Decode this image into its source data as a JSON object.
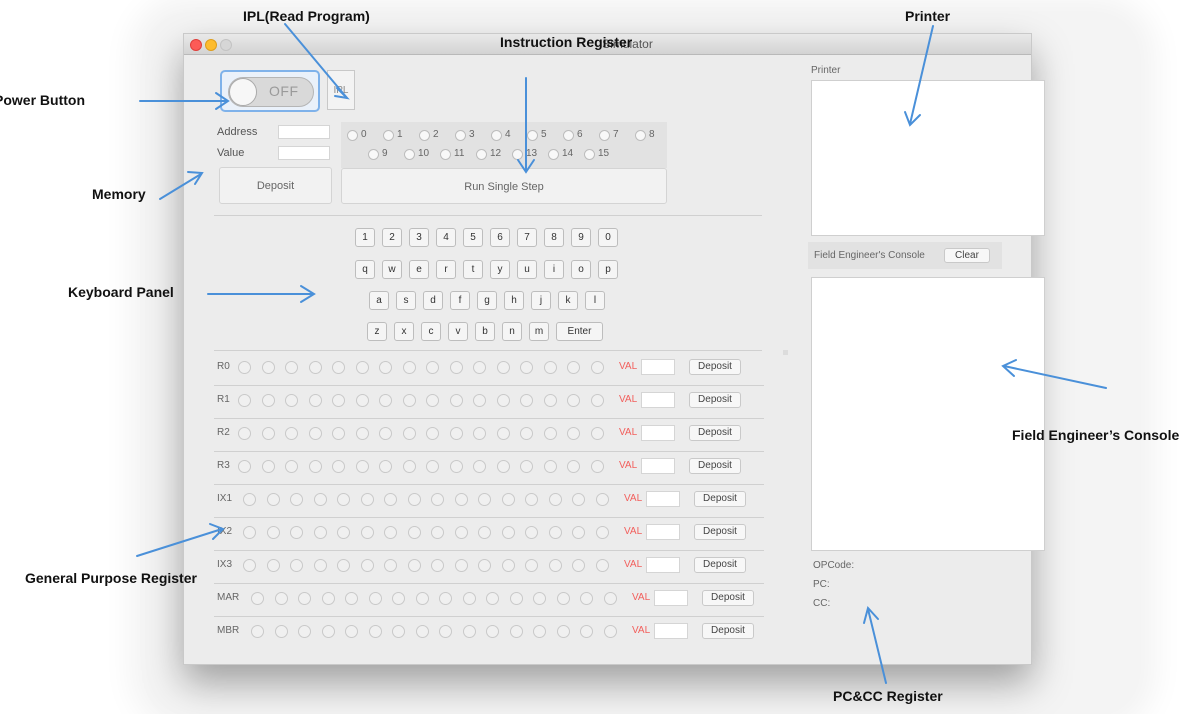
{
  "window": {
    "title": "Simulator"
  },
  "power": {
    "label": "OFF"
  },
  "ipl": {
    "label": "IPL"
  },
  "memory": {
    "address_label": "Address",
    "value_label": "Value",
    "address_value": "",
    "value_value": "",
    "deposit_label": "Deposit"
  },
  "instruction": {
    "bits": [
      "0",
      "1",
      "2",
      "3",
      "4",
      "5",
      "6",
      "7",
      "8",
      "9",
      "10",
      "11",
      "12",
      "13",
      "14",
      "15"
    ],
    "run_label": "Run Single Step"
  },
  "keyboard": {
    "row1": [
      "1",
      "2",
      "3",
      "4",
      "5",
      "6",
      "7",
      "8",
      "9",
      "0"
    ],
    "row2": [
      "q",
      "w",
      "e",
      "r",
      "t",
      "y",
      "u",
      "i",
      "o",
      "p"
    ],
    "row3": [
      "a",
      "s",
      "d",
      "f",
      "g",
      "h",
      "j",
      "k",
      "l"
    ],
    "row4": [
      "z",
      "x",
      "c",
      "v",
      "b",
      "n",
      "m",
      "Enter"
    ]
  },
  "registers": {
    "val_label": "VAL",
    "deposit_label": "Deposit",
    "items": [
      {
        "name": "R0",
        "value": ""
      },
      {
        "name": "R1",
        "value": ""
      },
      {
        "name": "R2",
        "value": ""
      },
      {
        "name": "R3",
        "value": ""
      },
      {
        "name": "IX1",
        "value": ""
      },
      {
        "name": "IX2",
        "value": ""
      },
      {
        "name": "IX3",
        "value": ""
      },
      {
        "name": "MAR",
        "value": ""
      },
      {
        "name": "MBR",
        "value": ""
      }
    ]
  },
  "printer": {
    "label": "Printer",
    "content": ""
  },
  "console": {
    "label": "Field Engineer's Console",
    "clear_label": "Clear",
    "content": ""
  },
  "pcc": {
    "opcode_label": "OPCode:",
    "pc_label": "PC:",
    "cc_label": "CC:"
  },
  "callouts": {
    "ipl": "IPL(Read Program)",
    "instruction_register": "Instruction Register",
    "printer": "Printer",
    "power_button": "Power Button",
    "memory": "Memory",
    "keyboard_panel": "Keyboard Panel",
    "field_engineer_console": "Field Engineer’s Console",
    "general_purpose_register": "General Purpose Register",
    "pccc_register": "PC&CC Register"
  },
  "colors": {
    "arrow": "#4a90d9",
    "val_text": "#f25f5c",
    "power_border": "#7fb2ea"
  }
}
